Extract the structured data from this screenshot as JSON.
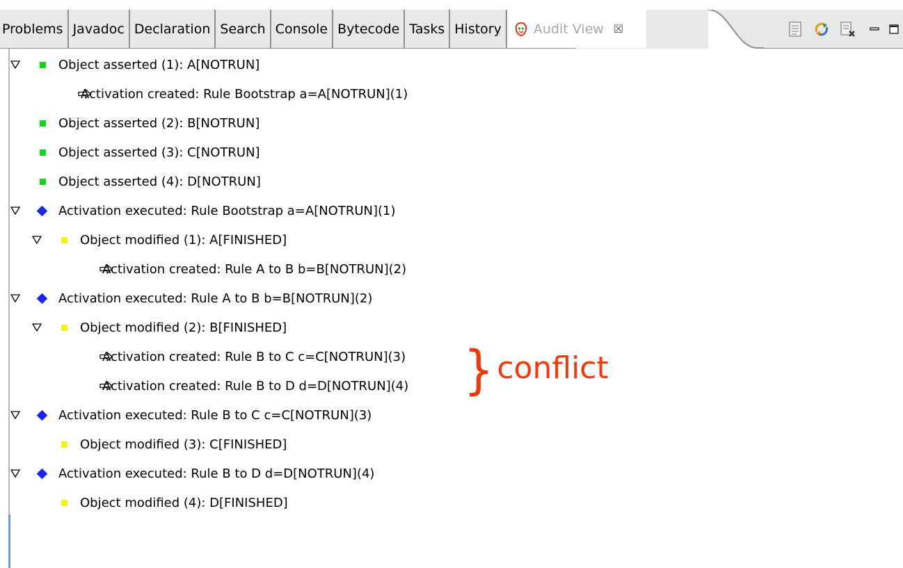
{
  "tabs": [
    {
      "label": "Problems"
    },
    {
      "label": "Javadoc"
    },
    {
      "label": "Declaration"
    },
    {
      "label": "Search"
    },
    {
      "label": "Console"
    },
    {
      "label": "Bytecode"
    },
    {
      "label": "Tasks"
    },
    {
      "label": "History"
    }
  ],
  "active_tab": {
    "label": "Audit View",
    "close_glyph": "☒",
    "icon": "audit-view-icon"
  },
  "toolbar": [
    {
      "icon": "document-icon"
    },
    {
      "icon": "refresh-icon"
    },
    {
      "icon": "clear-log-icon"
    },
    {
      "icon": "minimize-icon"
    },
    {
      "icon": "maximize-icon"
    }
  ],
  "tree": [
    {
      "level": 0,
      "expanded": true,
      "icon": "object-asserted-icon",
      "label": "Object asserted (1): A[NOTRUN]"
    },
    {
      "level": 1,
      "expanded": null,
      "icon": "activation-created-icon",
      "label": "Activation created: Rule Bootstrap a=A[NOTRUN](1)"
    },
    {
      "level": 0,
      "expanded": null,
      "icon": "object-asserted-icon",
      "label": "Object asserted (2): B[NOTRUN]"
    },
    {
      "level": 0,
      "expanded": null,
      "icon": "object-asserted-icon",
      "label": "Object asserted (3): C[NOTRUN]"
    },
    {
      "level": 0,
      "expanded": null,
      "icon": "object-asserted-icon",
      "label": "Object asserted (4): D[NOTRUN]"
    },
    {
      "level": 0,
      "expanded": true,
      "icon": "activation-executed-icon",
      "label": "Activation executed: Rule Bootstrap a=A[NOTRUN](1)"
    },
    {
      "level": 1,
      "expanded": true,
      "icon": "object-modified-icon",
      "label": "Object modified (1): A[FINISHED]"
    },
    {
      "level": 2,
      "expanded": null,
      "icon": "activation-created-icon",
      "label": "Activation created: Rule A to B b=B[NOTRUN](2)"
    },
    {
      "level": 0,
      "expanded": true,
      "icon": "activation-executed-icon",
      "label": "Activation executed: Rule A to B b=B[NOTRUN](2)"
    },
    {
      "level": 1,
      "expanded": true,
      "icon": "object-modified-icon",
      "label": "Object modified (2): B[FINISHED]"
    },
    {
      "level": 2,
      "expanded": null,
      "icon": "activation-created-icon",
      "label": "Activation created: Rule B to C c=C[NOTRUN](3)"
    },
    {
      "level": 2,
      "expanded": null,
      "icon": "activation-created-icon",
      "label": "Activation created: Rule B to D d=D[NOTRUN](4)"
    },
    {
      "level": 0,
      "expanded": true,
      "icon": "activation-executed-icon",
      "label": "Activation executed: Rule B to C c=C[NOTRUN](3)"
    },
    {
      "level": 1,
      "expanded": null,
      "icon": "object-modified-icon",
      "label": "Object modified (3): C[FINISHED]"
    },
    {
      "level": 0,
      "expanded": true,
      "icon": "activation-executed-icon",
      "label": "Activation executed: Rule B to D d=D[NOTRUN](4)"
    },
    {
      "level": 1,
      "expanded": null,
      "icon": "object-modified-icon",
      "label": "Object modified (4): D[FINISHED]"
    }
  ],
  "annotation": {
    "brace": "}",
    "text": "conflict",
    "color": "#f03a0d"
  },
  "colors": {
    "asserted": "#10d81c",
    "modified": "#f5f211",
    "executed": "#1a26e4"
  }
}
